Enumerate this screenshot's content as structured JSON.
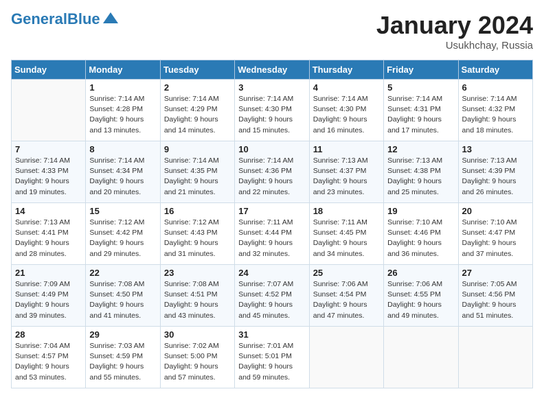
{
  "header": {
    "logo_line1": "General",
    "logo_line2": "Blue",
    "month": "January 2024",
    "location": "Usukhchay, Russia"
  },
  "weekdays": [
    "Sunday",
    "Monday",
    "Tuesday",
    "Wednesday",
    "Thursday",
    "Friday",
    "Saturday"
  ],
  "weeks": [
    [
      {
        "day": "",
        "sunrise": "",
        "sunset": "",
        "daylight": ""
      },
      {
        "day": "1",
        "sunrise": "Sunrise: 7:14 AM",
        "sunset": "Sunset: 4:28 PM",
        "daylight": "Daylight: 9 hours and 13 minutes."
      },
      {
        "day": "2",
        "sunrise": "Sunrise: 7:14 AM",
        "sunset": "Sunset: 4:29 PM",
        "daylight": "Daylight: 9 hours and 14 minutes."
      },
      {
        "day": "3",
        "sunrise": "Sunrise: 7:14 AM",
        "sunset": "Sunset: 4:30 PM",
        "daylight": "Daylight: 9 hours and 15 minutes."
      },
      {
        "day": "4",
        "sunrise": "Sunrise: 7:14 AM",
        "sunset": "Sunset: 4:30 PM",
        "daylight": "Daylight: 9 hours and 16 minutes."
      },
      {
        "day": "5",
        "sunrise": "Sunrise: 7:14 AM",
        "sunset": "Sunset: 4:31 PM",
        "daylight": "Daylight: 9 hours and 17 minutes."
      },
      {
        "day": "6",
        "sunrise": "Sunrise: 7:14 AM",
        "sunset": "Sunset: 4:32 PM",
        "daylight": "Daylight: 9 hours and 18 minutes."
      }
    ],
    [
      {
        "day": "7",
        "sunrise": "Sunrise: 7:14 AM",
        "sunset": "Sunset: 4:33 PM",
        "daylight": "Daylight: 9 hours and 19 minutes."
      },
      {
        "day": "8",
        "sunrise": "Sunrise: 7:14 AM",
        "sunset": "Sunset: 4:34 PM",
        "daylight": "Daylight: 9 hours and 20 minutes."
      },
      {
        "day": "9",
        "sunrise": "Sunrise: 7:14 AM",
        "sunset": "Sunset: 4:35 PM",
        "daylight": "Daylight: 9 hours and 21 minutes."
      },
      {
        "day": "10",
        "sunrise": "Sunrise: 7:14 AM",
        "sunset": "Sunset: 4:36 PM",
        "daylight": "Daylight: 9 hours and 22 minutes."
      },
      {
        "day": "11",
        "sunrise": "Sunrise: 7:13 AM",
        "sunset": "Sunset: 4:37 PM",
        "daylight": "Daylight: 9 hours and 23 minutes."
      },
      {
        "day": "12",
        "sunrise": "Sunrise: 7:13 AM",
        "sunset": "Sunset: 4:38 PM",
        "daylight": "Daylight: 9 hours and 25 minutes."
      },
      {
        "day": "13",
        "sunrise": "Sunrise: 7:13 AM",
        "sunset": "Sunset: 4:39 PM",
        "daylight": "Daylight: 9 hours and 26 minutes."
      }
    ],
    [
      {
        "day": "14",
        "sunrise": "Sunrise: 7:13 AM",
        "sunset": "Sunset: 4:41 PM",
        "daylight": "Daylight: 9 hours and 28 minutes."
      },
      {
        "day": "15",
        "sunrise": "Sunrise: 7:12 AM",
        "sunset": "Sunset: 4:42 PM",
        "daylight": "Daylight: 9 hours and 29 minutes."
      },
      {
        "day": "16",
        "sunrise": "Sunrise: 7:12 AM",
        "sunset": "Sunset: 4:43 PM",
        "daylight": "Daylight: 9 hours and 31 minutes."
      },
      {
        "day": "17",
        "sunrise": "Sunrise: 7:11 AM",
        "sunset": "Sunset: 4:44 PM",
        "daylight": "Daylight: 9 hours and 32 minutes."
      },
      {
        "day": "18",
        "sunrise": "Sunrise: 7:11 AM",
        "sunset": "Sunset: 4:45 PM",
        "daylight": "Daylight: 9 hours and 34 minutes."
      },
      {
        "day": "19",
        "sunrise": "Sunrise: 7:10 AM",
        "sunset": "Sunset: 4:46 PM",
        "daylight": "Daylight: 9 hours and 36 minutes."
      },
      {
        "day": "20",
        "sunrise": "Sunrise: 7:10 AM",
        "sunset": "Sunset: 4:47 PM",
        "daylight": "Daylight: 9 hours and 37 minutes."
      }
    ],
    [
      {
        "day": "21",
        "sunrise": "Sunrise: 7:09 AM",
        "sunset": "Sunset: 4:49 PM",
        "daylight": "Daylight: 9 hours and 39 minutes."
      },
      {
        "day": "22",
        "sunrise": "Sunrise: 7:08 AM",
        "sunset": "Sunset: 4:50 PM",
        "daylight": "Daylight: 9 hours and 41 minutes."
      },
      {
        "day": "23",
        "sunrise": "Sunrise: 7:08 AM",
        "sunset": "Sunset: 4:51 PM",
        "daylight": "Daylight: 9 hours and 43 minutes."
      },
      {
        "day": "24",
        "sunrise": "Sunrise: 7:07 AM",
        "sunset": "Sunset: 4:52 PM",
        "daylight": "Daylight: 9 hours and 45 minutes."
      },
      {
        "day": "25",
        "sunrise": "Sunrise: 7:06 AM",
        "sunset": "Sunset: 4:54 PM",
        "daylight": "Daylight: 9 hours and 47 minutes."
      },
      {
        "day": "26",
        "sunrise": "Sunrise: 7:06 AM",
        "sunset": "Sunset: 4:55 PM",
        "daylight": "Daylight: 9 hours and 49 minutes."
      },
      {
        "day": "27",
        "sunrise": "Sunrise: 7:05 AM",
        "sunset": "Sunset: 4:56 PM",
        "daylight": "Daylight: 9 hours and 51 minutes."
      }
    ],
    [
      {
        "day": "28",
        "sunrise": "Sunrise: 7:04 AM",
        "sunset": "Sunset: 4:57 PM",
        "daylight": "Daylight: 9 hours and 53 minutes."
      },
      {
        "day": "29",
        "sunrise": "Sunrise: 7:03 AM",
        "sunset": "Sunset: 4:59 PM",
        "daylight": "Daylight: 9 hours and 55 minutes."
      },
      {
        "day": "30",
        "sunrise": "Sunrise: 7:02 AM",
        "sunset": "Sunset: 5:00 PM",
        "daylight": "Daylight: 9 hours and 57 minutes."
      },
      {
        "day": "31",
        "sunrise": "Sunrise: 7:01 AM",
        "sunset": "Sunset: 5:01 PM",
        "daylight": "Daylight: 9 hours and 59 minutes."
      },
      {
        "day": "",
        "sunrise": "",
        "sunset": "",
        "daylight": ""
      },
      {
        "day": "",
        "sunrise": "",
        "sunset": "",
        "daylight": ""
      },
      {
        "day": "",
        "sunrise": "",
        "sunset": "",
        "daylight": ""
      }
    ]
  ]
}
